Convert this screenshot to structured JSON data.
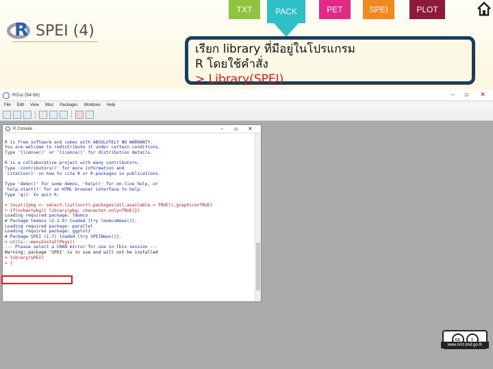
{
  "slide": {
    "logo_letter": "R",
    "logo_text": "SPEI (4)",
    "nav": [
      "TXT",
      "PACK",
      "PET",
      "SPEI",
      "PLOT"
    ],
    "callout": {
      "line1": "เรียก library ที่มีอยู่ในโปรแกรม",
      "line2": "R โดยใช้คำสั่ง",
      "line3": "> Library(SPEI)"
    },
    "cc_url": "www.nrct.tmd.go.th"
  },
  "rgui": {
    "title": "RGui (64-bit)",
    "menu": [
      "File",
      "Edit",
      "View",
      "Misc",
      "Packages",
      "Windows",
      "Help"
    ],
    "console_title": "R Console",
    "lines": [
      {
        "t": "",
        "c": "blue"
      },
      {
        "t": "R is free software and comes with ABSOLUTELY NO WARRANTY.",
        "c": "blue"
      },
      {
        "t": "You are welcome to redistribute it under certain conditions.",
        "c": "blue"
      },
      {
        "t": "Type 'license()' or 'licence()' for distribution details.",
        "c": "blue"
      },
      {
        "t": "",
        "c": "blue"
      },
      {
        "t": "R is a collaborative project with many contributors.",
        "c": "blue"
      },
      {
        "t": "Type 'contributors()' for more information and",
        "c": "blue"
      },
      {
        "t": "'citation()' on how to cite R or R packages in publications.",
        "c": "blue"
      },
      {
        "t": "",
        "c": "blue"
      },
      {
        "t": "Type 'demo()' for some demos, 'help()' for on-line help, or",
        "c": "blue"
      },
      {
        "t": "'help.start()' for an HTML browser interface to help.",
        "c": "blue"
      },
      {
        "t": "Type 'q()' to quit R.",
        "c": "blue"
      },
      {
        "t": "",
        "c": "blue"
      },
      {
        "t": "> local({pkg <- select.list(sort(.packages(all.available = TRUE)),graphics=TRUE)",
        "c": "red"
      },
      {
        "t": "+ if(nchar(pkg)) library(pkg, character.only=TRUE)})",
        "c": "red"
      },
      {
        "t": "Loading required package: lmomco",
        "c": "blue"
      },
      {
        "t": "# Package lmomco (2.2.9) loaded [try lmomcoNews()].",
        "c": "blue"
      },
      {
        "t": "Loading required package: parallel",
        "c": "blue"
      },
      {
        "t": "Loading required package: ggplot2",
        "c": "blue"
      },
      {
        "t": "# Package SPEI (1.7) loaded [try SPEINews()].",
        "c": "blue"
      },
      {
        "t": "> utils:::menuInstallPkgs()",
        "c": "red"
      },
      {
        "t": "--- Please select a CRAN mirror for use in this session ---",
        "c": "blue"
      },
      {
        "t": "Warning: package 'SPEI' is in use and will not be installed",
        "c": "black"
      },
      {
        "t": "> library(SPEI)",
        "c": "red"
      },
      {
        "t": "> |",
        "c": "red"
      }
    ]
  }
}
